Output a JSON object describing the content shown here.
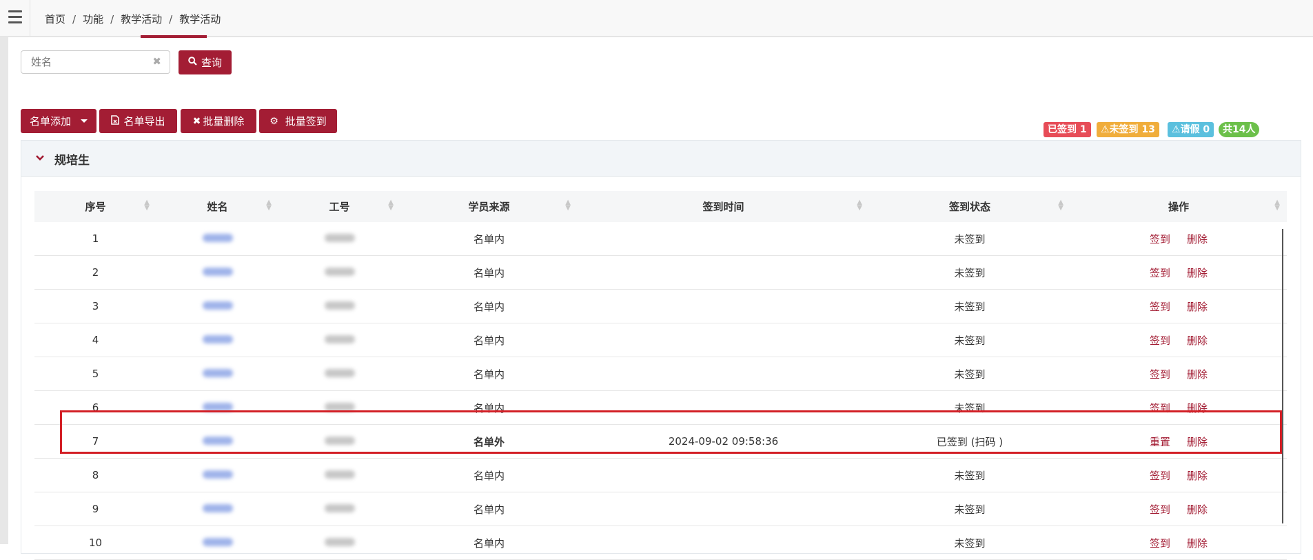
{
  "breadcrumb": [
    "首页",
    "功能",
    "教学活动",
    "教学活动"
  ],
  "breadcrumb_sep": "/",
  "search": {
    "placeholder": "姓名",
    "value": "",
    "button": "查询"
  },
  "toolbar": {
    "add": "名单添加",
    "export": "名单导出",
    "batch_delete": "批量删除",
    "batch_sign": "批量签到"
  },
  "badges": {
    "signed": "已签到 1",
    "unsigned": "未签到 13",
    "leave": "请假 0",
    "total": "共14人"
  },
  "colors": {
    "primary": "#a31d34",
    "signed": "#e74c57",
    "unsigned": "#f0ad3b",
    "leave": "#5bc0de",
    "total": "#6cc04a",
    "outside": "#e38b00"
  },
  "panel": {
    "title": "规培生"
  },
  "table": {
    "columns": [
      "序号",
      "姓名",
      "工号",
      "学员来源",
      "签到时间",
      "签到状态",
      "操作"
    ],
    "rows": [
      {
        "no": "1",
        "source": "名单内",
        "time": "",
        "status": "未签到",
        "op1": "签到",
        "op2": "删除"
      },
      {
        "no": "2",
        "source": "名单内",
        "time": "",
        "status": "未签到",
        "op1": "签到",
        "op2": "删除"
      },
      {
        "no": "3",
        "source": "名单内",
        "time": "",
        "status": "未签到",
        "op1": "签到",
        "op2": "删除"
      },
      {
        "no": "4",
        "source": "名单内",
        "time": "",
        "status": "未签到",
        "op1": "签到",
        "op2": "删除"
      },
      {
        "no": "5",
        "source": "名单内",
        "time": "",
        "status": "未签到",
        "op1": "签到",
        "op2": "删除"
      },
      {
        "no": "6",
        "source": "名单内",
        "time": "",
        "status": "未签到",
        "op1": "签到",
        "op2": "删除"
      },
      {
        "no": "7",
        "source": "名单外",
        "time": "2024-09-02 09:58:36",
        "status": "已签到 (扫码 )",
        "op1": "重置",
        "op2": "删除"
      },
      {
        "no": "8",
        "source": "名单内",
        "time": "",
        "status": "未签到",
        "op1": "签到",
        "op2": "删除"
      },
      {
        "no": "9",
        "source": "名单内",
        "time": "",
        "status": "未签到",
        "op1": "签到",
        "op2": "删除"
      },
      {
        "no": "10",
        "source": "名单内",
        "time": "",
        "status": "未签到",
        "op1": "签到",
        "op2": "删除"
      }
    ]
  }
}
